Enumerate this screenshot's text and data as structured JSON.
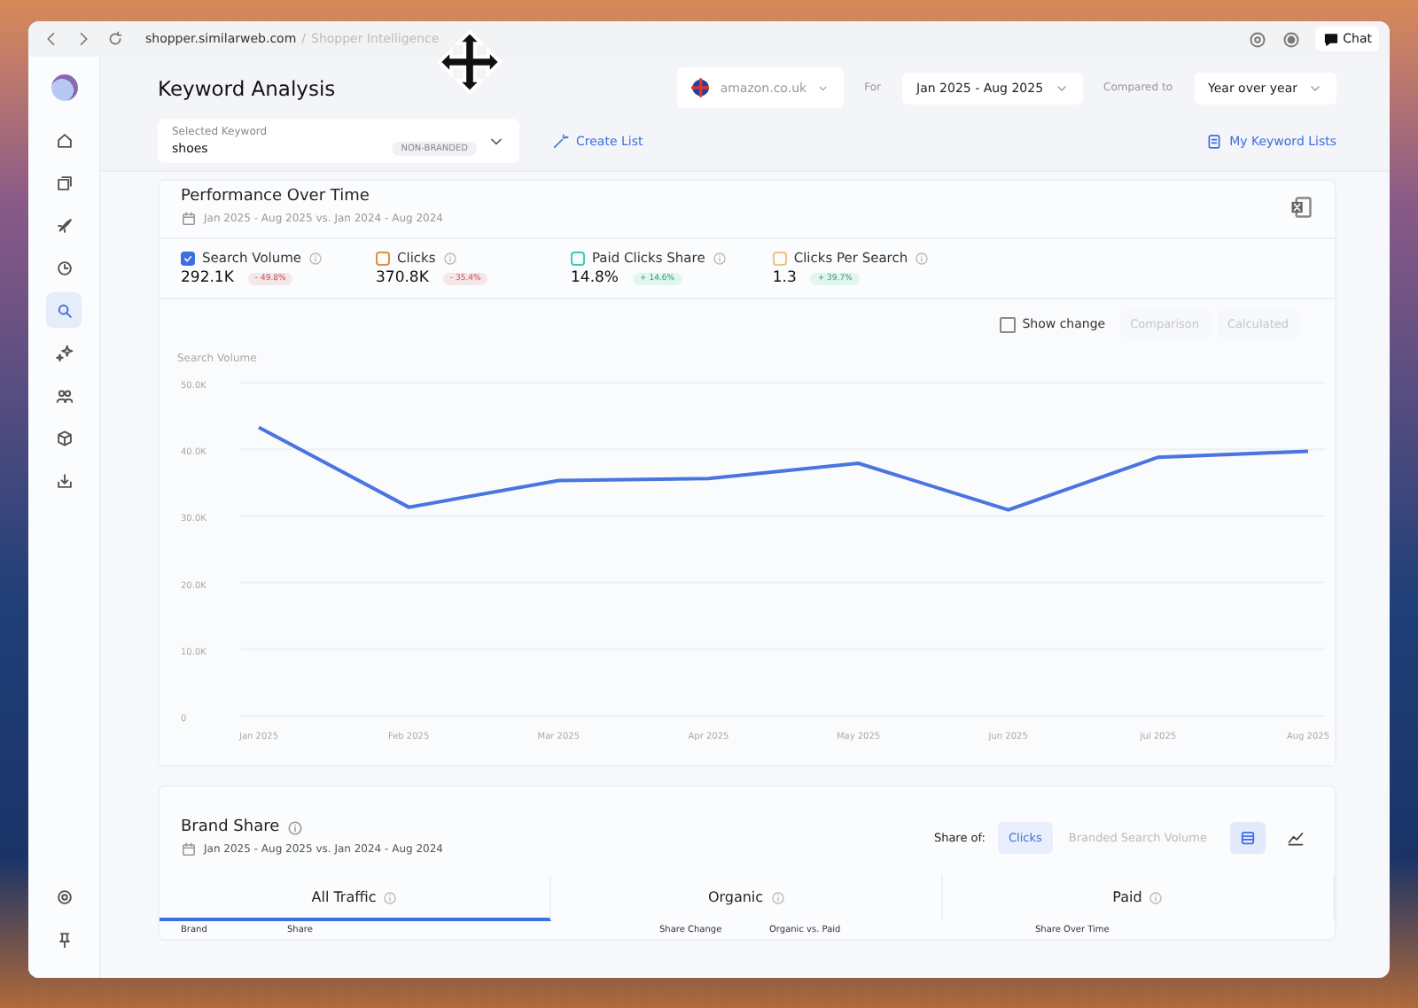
{
  "browser": {
    "url": "shopper.similarweb.com",
    "separator": "/",
    "breadcrumb": "Shopper Intelligence",
    "chat": "Chat"
  },
  "sidebar": {
    "items": [
      {
        "kind": "home",
        "selected": false
      },
      {
        "kind": "pages",
        "selected": false
      },
      {
        "kind": "rocket",
        "selected": false
      },
      {
        "kind": "clock",
        "selected": false
      },
      {
        "kind": "search",
        "selected": true
      },
      {
        "kind": "sparkle",
        "selected": false
      },
      {
        "kind": "people",
        "selected": false
      },
      {
        "kind": "box",
        "selected": false
      },
      {
        "kind": "download",
        "selected": false
      }
    ],
    "bottom": [
      {
        "kind": "settings"
      },
      {
        "kind": "pin"
      }
    ]
  },
  "header": {
    "title": "Keyword Analysis",
    "domain": "amazon.co.uk",
    "for_label": "For",
    "date_range": "Jan 2025 - Aug 2025",
    "compared_label": "Compared to",
    "comparison": "Year over year"
  },
  "keyword": {
    "label": "Selected Keyword",
    "value": "shoes",
    "badge": "NON-BRANDED",
    "create_list": "Create List",
    "my_lists": "My Keyword Lists"
  },
  "performance": {
    "title": "Performance Over Time",
    "dates": "Jan 2025 - Aug 2025 vs. Jan 2024 - Aug 2024",
    "metrics": [
      {
        "label": "Search Volume",
        "value": "292.1K",
        "change": "- 49.8%",
        "kind": "decrease",
        "checked": true,
        "color": "#3e6fe0"
      },
      {
        "label": "Clicks",
        "value": "370.8K",
        "change": "- 35.4%",
        "kind": "decrease",
        "checked": false,
        "color": "#e0913e"
      },
      {
        "label": "Paid Clicks Share",
        "value": "14.8%",
        "change": "+ 14.6%",
        "kind": "increase",
        "checked": false,
        "color": "#3ec9b6"
      },
      {
        "label": "Clicks Per Search",
        "value": "1.3",
        "change": "+ 39.7%",
        "kind": "increase",
        "checked": false,
        "color": "#f0c27a"
      }
    ],
    "show_change": {
      "label": "Show change",
      "checked": false
    },
    "modes": [
      {
        "label": "Comparison",
        "disabled": true
      },
      {
        "label": "Calculated",
        "disabled": true
      }
    ],
    "chart_data": {
      "type": "line",
      "ylabel": "Search Volume",
      "grid": true,
      "categories": [
        "Jan 2025",
        "Feb 2025",
        "Mar 2025",
        "Apr 2025",
        "May 2025",
        "Jun 2025",
        "Jul 2025",
        "Aug 2025"
      ],
      "series": [
        {
          "color": "#4a74e0",
          "values": [
            43300,
            31300,
            35300,
            35600,
            37900,
            30900,
            38800,
            39700
          ]
        }
      ],
      "ylim": [
        0,
        50000
      ],
      "yticks": [
        {
          "value": 0,
          "label": "0"
        },
        {
          "value": 10000,
          "label": "10.0K"
        },
        {
          "value": 20000,
          "label": "20.0K"
        },
        {
          "value": 30000,
          "label": "30.0K"
        },
        {
          "value": 40000,
          "label": "40.0K"
        },
        {
          "value": 50000,
          "label": "50.0K"
        }
      ]
    }
  },
  "brand_share": {
    "title": "Brand Share",
    "dates": "Jan 2025 - Aug 2025 vs. Jan 2024 - Aug 2024",
    "share_of_label": "Share of:",
    "share_of": [
      {
        "label": "Clicks",
        "selected": true
      },
      {
        "label": "Branded Search Volume",
        "selected": false
      }
    ],
    "views": [
      {
        "kind": "table",
        "selected": true
      },
      {
        "kind": "line",
        "selected": false
      }
    ],
    "tabs": [
      {
        "label": "All Traffic",
        "selected": true
      },
      {
        "label": "Organic",
        "selected": false
      },
      {
        "label": "Paid",
        "selected": false
      }
    ],
    "columns": [
      "Brand",
      "Share",
      "Share Change",
      "Organic vs. Paid",
      "Share Over Time"
    ]
  }
}
